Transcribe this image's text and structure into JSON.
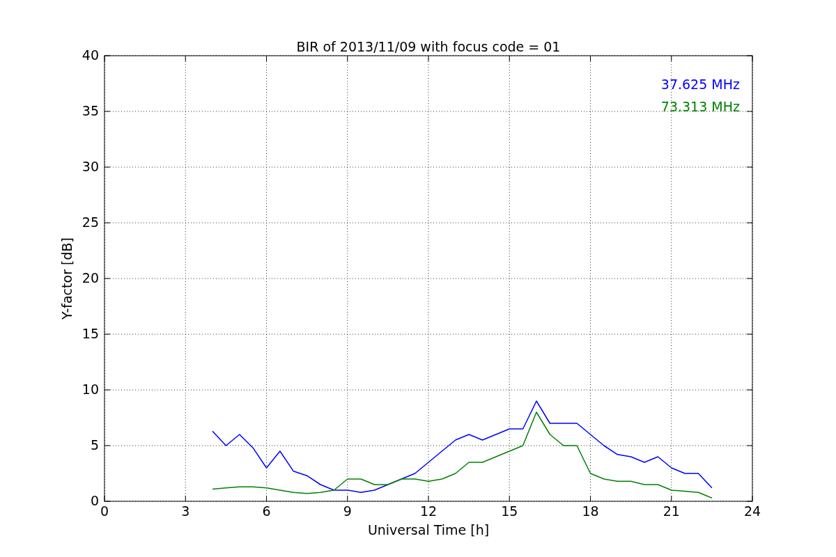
{
  "figure": {
    "chart_data": {
      "type": "line",
      "title": "BIR of 2013/11/09 with focus code = 01",
      "xlabel": "Universal Time [h]",
      "ylabel": "Y-factor [dB]",
      "x": [
        4,
        4.5,
        5,
        5.5,
        6,
        6.5,
        7,
        7.5,
        8,
        8.5,
        9,
        9.5,
        10,
        10.5,
        11,
        11.5,
        12,
        12.5,
        13,
        13.5,
        14,
        14.5,
        15,
        15.5,
        16,
        16.5,
        17,
        17.5,
        18,
        18.5,
        19,
        19.5,
        20,
        20.5,
        21,
        21.5,
        22,
        22.5
      ],
      "series": [
        {
          "name": "37.625 MHz",
          "color": "#0000ff",
          "values": [
            6.3,
            5,
            6,
            4.8,
            3,
            4.5,
            2.7,
            2.3,
            1.5,
            1,
            1,
            0.8,
            1,
            1.5,
            2,
            2.5,
            3.5,
            4.5,
            5.5,
            6,
            5.5,
            6,
            6.5,
            6.5,
            9,
            7,
            7,
            7,
            6,
            5,
            4.2,
            4,
            3.5,
            4,
            3,
            2.5,
            2.5,
            1.2
          ]
        },
        {
          "name": "73.313 MHz",
          "color": "#008000",
          "values": [
            1.1,
            1.2,
            1.3,
            1.3,
            1.2,
            1,
            0.8,
            0.7,
            0.8,
            1,
            2,
            2,
            1.5,
            1.5,
            2,
            2,
            1.8,
            2,
            2.5,
            3.5,
            3.5,
            4,
            4.5,
            5,
            8,
            6,
            5,
            5,
            2.5,
            2,
            1.8,
            1.8,
            1.5,
            1.5,
            1,
            0.9,
            0.8,
            0.3
          ]
        }
      ],
      "grid": true,
      "xlim": [
        0,
        24
      ],
      "ylim": [
        0,
        40
      ],
      "xticks": [
        0,
        3,
        6,
        9,
        12,
        15,
        18,
        21,
        24
      ],
      "yticks": [
        0,
        5,
        10,
        15,
        20,
        25,
        30,
        35,
        40
      ]
    }
  }
}
